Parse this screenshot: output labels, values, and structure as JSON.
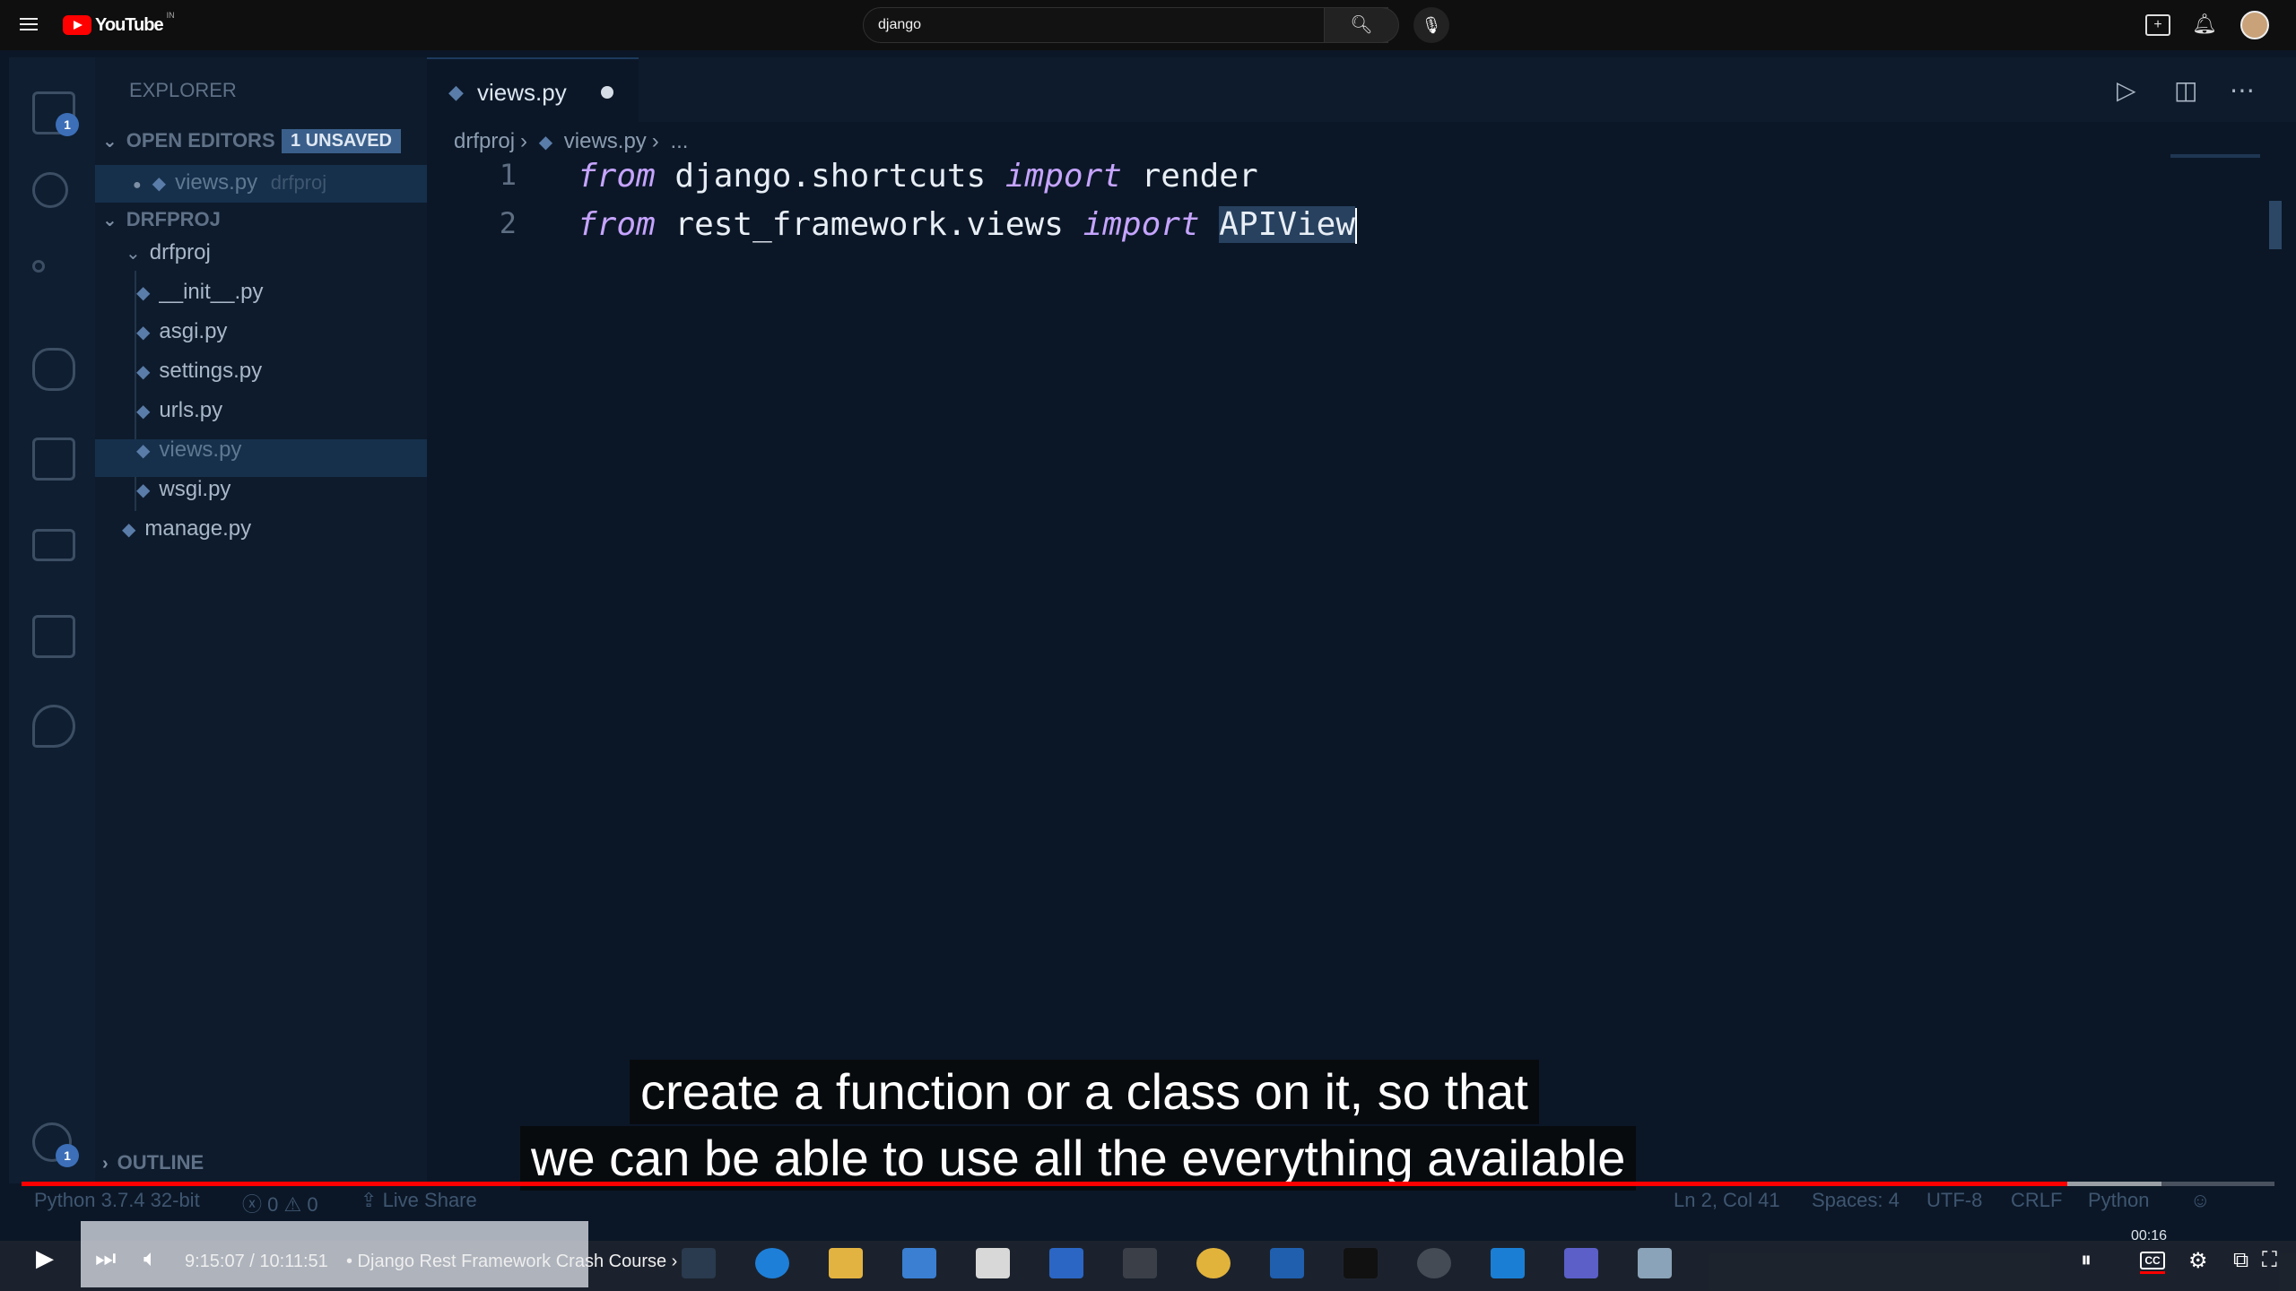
{
  "youtube": {
    "logo_text": "YouTube",
    "logo_country": "IN",
    "search_value": "django",
    "video_time": "9:15:07 / 10:11:51",
    "chapter": "• Django Rest Framework Crash Course ›",
    "clock": "00:16"
  },
  "explorer": {
    "title": "EXPLORER",
    "open_editors_label": "OPEN EDITORS",
    "unsaved_badge": "1 UNSAVED",
    "open_file": "views.py",
    "open_file_folder": "drfproj",
    "project_label": "DRFPROJ",
    "folder": "drfproj",
    "files": [
      "__init__.py",
      "asgi.py",
      "settings.py",
      "urls.py",
      "views.py",
      "wsgi.py"
    ],
    "root_file": "manage.py",
    "outline_label": "OUTLINE"
  },
  "activity": {
    "explorer_badge": "1",
    "settings_badge": "1"
  },
  "editor": {
    "tab_label": "views.py",
    "breadcrumb": [
      "drfproj",
      "views.py",
      "..."
    ],
    "lines": [
      {
        "num": "1",
        "kw1": "from",
        "mod": "django.shortcuts",
        "kw2": "import",
        "name": "render"
      },
      {
        "num": "2",
        "kw1": "from",
        "mod": "rest_framework.views",
        "kw2": "import",
        "name": "APIView"
      }
    ]
  },
  "statusbar": {
    "interpreter": "Python 3.7.4 32-bit",
    "errors": "0",
    "warnings": "0",
    "live_share": "Live Share",
    "position": "Ln 2, Col 41",
    "spaces": "Spaces: 4",
    "encoding": "UTF-8",
    "eol": "CRLF",
    "language": "Python"
  },
  "captions": {
    "line1": "create a function or a class on it, so that",
    "line2": "we can be able to use all the everything available"
  },
  "progress": {
    "played_fraction": 0.908,
    "buffered_fraction": 0.95
  },
  "colors": {
    "keyword": "#c6a4ff",
    "editor_bg": "#0b1727",
    "youtube_red": "#ff0000"
  }
}
